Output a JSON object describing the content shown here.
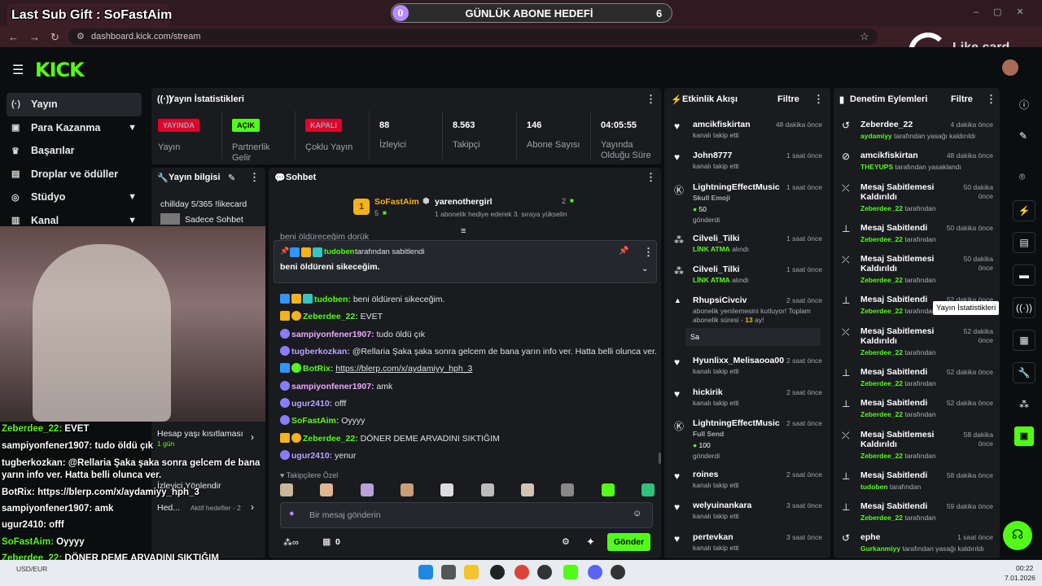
{
  "browser": {
    "url": "dashboard.kick.com/stream",
    "tab_title": "Kick Dashboard"
  },
  "overlay": {
    "last_sub_gift": "Last Sub Gift : SoFastAim",
    "goal_title": "GÜNLÜK ABONE HEDEFİ",
    "goal_current": "0",
    "goal_target": "6",
    "likecard": "Like card",
    "chat": [
      {
        "user": "Zeberdee_22:",
        "text": "EVET",
        "color": "#53fc18"
      },
      {
        "user": "sampiyonfener1907:",
        "text": "tudo öldü çık",
        "color": "#ffffff"
      },
      {
        "user": "tugberkozkan:",
        "text": "@Rellaria Şaka şaka sonra gelcem de bana",
        "color": "#ffffff"
      },
      {
        "user": "",
        "text": "yarın info ver. Hatta belli olunca ver.",
        "color": "#ffffff"
      },
      {
        "user": "BotRix:",
        "text": "https://blerp.com/x/aydamiyy_hph_3",
        "color": "#ffffff"
      },
      {
        "user": "sampiyonfener1907:",
        "text": "amk",
        "color": "#ffffff"
      },
      {
        "user": "ugur2410:",
        "text": "offf",
        "color": "#ffffff"
      },
      {
        "user": "SoFastAim:",
        "text": "Oyyyy",
        "color": "#53fc18"
      },
      {
        "user": "Zeberdee_22:",
        "text": "DÖNER DEME ARVADINI SIKTIĞIM",
        "color": "#53fc18"
      },
      {
        "user": "ugur2410:",
        "text": "yenur",
        "color": "#ffffff"
      }
    ]
  },
  "sidebar": {
    "items": [
      {
        "label": "Yayın",
        "icon": "broadcast-icon"
      },
      {
        "label": "Para Kazanma",
        "icon": "money-icon"
      },
      {
        "label": "Başarılar",
        "icon": "trophy-icon"
      },
      {
        "label": "Droplar ve ödüller",
        "icon": "gift-icon"
      },
      {
        "label": "Stüdyo",
        "icon": "studio-icon"
      },
      {
        "label": "Kanal",
        "icon": "channel-icon"
      }
    ]
  },
  "stats": {
    "title": "Yayın İstatistikleri",
    "items": [
      {
        "badge": "YAYINDA",
        "label": "Yayın",
        "color": "#e4002b"
      },
      {
        "badge": "AÇIK",
        "label": "Partnerlik Gelir",
        "color": "#53fc18"
      },
      {
        "badge": "KAPALI",
        "label": "Çoklu Yayın",
        "color": "#e4002b"
      },
      {
        "value": "88",
        "label": "İzleyici"
      },
      {
        "value": "8.563",
        "label": "Takipçi"
      },
      {
        "value": "146",
        "label": "Abone Sayısı"
      },
      {
        "value": "04:05:55",
        "label": "Yayında Olduğu Süre"
      }
    ]
  },
  "stream_info": {
    "title": "Yayın bilgisi",
    "stream_title": "chillday 5/365 !likecard",
    "category": "Sadece Sohbet",
    "age_restriction": "Hesap yaşı kısıtlaması",
    "age_value": "1 gün",
    "viewer_redirect": "İzleyici Yönlendir",
    "goals": "Hed...",
    "active_goals": "Aktif hedefler - 2"
  },
  "chat": {
    "title": "Sohbet",
    "gifter1": "SoFastAim",
    "gifter1_count": "5",
    "gifter2": "yarenothergirl",
    "gifter2_count": "2",
    "gift_note": "1 abonelik hediye ederek 3. sıraya yükselin",
    "partial_line": "beni öldüreceğim dorük",
    "pinned_by": "tudoben",
    "pinned_suffix": "tarafından sabitlendi",
    "pinned_text": "beni öldüreni sikeceğim.",
    "messages": [
      {
        "user": "tudoben:",
        "text": "beni öldüreni sikeceğim.",
        "color": "#53fc18"
      },
      {
        "user": "Zeberdee_22:",
        "text": "EVET",
        "color": "#53fc18"
      },
      {
        "user": "sampiyonfener1907:",
        "text": "tudo öldü çık",
        "color": "#f0a6ff"
      },
      {
        "user": "tugberkozkan:",
        "text": "@Rellaria Şaka şaka sonra gelcem de bana yarın info ver. Hatta belli olunca ver.",
        "color": "#b9a6ff"
      },
      {
        "user": "BotRix:",
        "text": "https://blerp.com/x/aydamiyy_hph_3",
        "color": "#53fc18"
      },
      {
        "user": "sampiyonfener1907:",
        "text": "amk",
        "color": "#f0a6ff"
      },
      {
        "user": "ugur2410:",
        "text": "offf",
        "color": "#b9a6ff"
      },
      {
        "user": "SoFastAim:",
        "text": "Oyyyy",
        "color": "#53fc18"
      },
      {
        "user": "Zeberdee_22:",
        "text": "DÖNER DEME ARVADINI SIKTIĞIM",
        "color": "#53fc18"
      },
      {
        "user": "ugur2410:",
        "text": "yenur",
        "color": "#b9a6ff"
      }
    ],
    "followers_label": "Takipçilere Özel",
    "placeholder": "Bir mesaj gönderin",
    "points": "0",
    "send": "Gönder"
  },
  "activity": {
    "title": "Etkinlik Akışı",
    "filter": "Filtre",
    "items": [
      {
        "name": "amcikfiskirtan",
        "sub": "kanalı takip etti",
        "time": "48 dakika önce",
        "icon": "heart-icon"
      },
      {
        "name": "John8777",
        "sub": "kanalı takip etti",
        "time": "1 saat önce",
        "icon": "heart-icon"
      },
      {
        "name": "LightningEffectMusic",
        "sub": "Skull Emoji",
        "extra": "50",
        "extra2": "gönderdi",
        "time": "1 saat önce",
        "icon": "kick-coin-icon"
      },
      {
        "name": "Cilveli_Tilki",
        "sub": "LİNK ATMA",
        "sub2": "alındı",
        "time": "1 saat önce",
        "icon": "points-icon"
      },
      {
        "name": "Cilveli_Tilki",
        "sub": "LİNK ATMA",
        "sub2": "alındı",
        "time": "1 saat önce",
        "icon": "points-icon"
      },
      {
        "name": "RhupsiCivciv",
        "sub": "abonelik yenilemesini kutluyor! Toplam abonelik süresi -",
        "months": "13",
        "monthsuffix": "ay!",
        "msg": "Sa",
        "time": "2 saat önce",
        "icon": "star-icon"
      },
      {
        "name": "Hyunlixx_Melisaooa00",
        "sub": "kanalı takip etti",
        "time": "2 saat önce",
        "icon": "heart-icon"
      },
      {
        "name": "hickirik",
        "sub": "kanalı takip etti",
        "time": "2 saat önce",
        "icon": "heart-icon"
      },
      {
        "name": "LightningEffectMusic",
        "sub": "Full Send",
        "extra": "100",
        "extra2": "gönderdi",
        "time": "2 saat önce",
        "icon": "kick-coin-icon"
      },
      {
        "name": "roines",
        "sub": "kanalı takip etti",
        "time": "2 saat önce",
        "icon": "heart-icon"
      },
      {
        "name": "welyuinankara",
        "sub": "kanalı takip etti",
        "time": "3 saat önce",
        "icon": "heart-icon"
      },
      {
        "name": "pertevkan",
        "sub": "kanalı takip etti",
        "time": "3 saat önce",
        "icon": "heart-icon"
      }
    ]
  },
  "moderation": {
    "title": "Denetim Eylemleri",
    "filter": "Filtre",
    "by_suffix": "tarafından",
    "items": [
      {
        "name": "Zeberdee_22",
        "by": "aydamiyy",
        "suffix": "tarafından yasağı kaldırıldı",
        "time": "4 dakika önce",
        "icon": "undo-icon"
      },
      {
        "name": "amcikfiskirtan",
        "by": "THEYUPS",
        "suffix": "tarafından yasaklandı",
        "time": "48 dakika önce",
        "icon": "ban-icon"
      },
      {
        "name": "Mesaj Sabitlemesi Kaldırıldı",
        "by": "Zeberdee_22",
        "suffix": "tarafından",
        "time": "50 dakika önce",
        "icon": "unpin-icon"
      },
      {
        "name": "Mesaj Sabitlendi",
        "by": "Zeberdee_22",
        "suffix": "tarafından",
        "time": "50 dakika önce",
        "icon": "pin-icon"
      },
      {
        "name": "Mesaj Sabitlemesi Kaldırıldı",
        "by": "Zeberdee_22",
        "suffix": "tarafından",
        "time": "50 dakika önce",
        "icon": "unpin-icon"
      },
      {
        "name": "Mesaj Sabitlendi",
        "by": "Zeberdee_22",
        "suffix": "tarafından",
        "time": "52 dakika önce",
        "icon": "pin-icon"
      },
      {
        "name": "Mesaj Sabitlemesi Kaldırıldı",
        "by": "Zeberdee_22",
        "suffix": "tarafından",
        "time": "52 dakika önce",
        "icon": "unpin-icon"
      },
      {
        "name": "Mesaj Sabitlendi",
        "by": "Zeberdee_22",
        "suffix": "tarafından",
        "time": "52 dakika önce",
        "icon": "pin-icon"
      },
      {
        "name": "Mesaj Sabitlendi",
        "by": "Zeberdee_22",
        "suffix": "tarafından",
        "time": "52 dakika önce",
        "icon": "pin-icon"
      },
      {
        "name": "Mesaj Sabitlemesi Kaldırıldı",
        "by": "Zeberdee_22",
        "suffix": "tarafından",
        "time": "58 dakika önce",
        "icon": "unpin-icon"
      },
      {
        "name": "Mesaj Sabitlendi",
        "by": "tudoben",
        "suffix": "tarafından",
        "time": "58 dakika önce",
        "icon": "pin-icon"
      },
      {
        "name": "Mesaj Sabitlendi",
        "by": "Zeberdee_22",
        "suffix": "tarafından",
        "time": "59 dakika önce",
        "icon": "pin-icon"
      },
      {
        "name": "ephe",
        "by": "Gurkanmiyy",
        "suffix": "tarafından yasağı kaldırıldı",
        "time": "1 saat önce",
        "icon": "undo-icon"
      }
    ]
  },
  "tooltip": "Yayın İstatistikleri",
  "taskbar": {
    "currency": "USD/EUR",
    "time": "00:22",
    "date": "7.01.2026"
  },
  "colors": {
    "accent": "#53fc18",
    "live": "#e4002b",
    "panel": "#191b1f",
    "bg": "#0b0e0f"
  }
}
